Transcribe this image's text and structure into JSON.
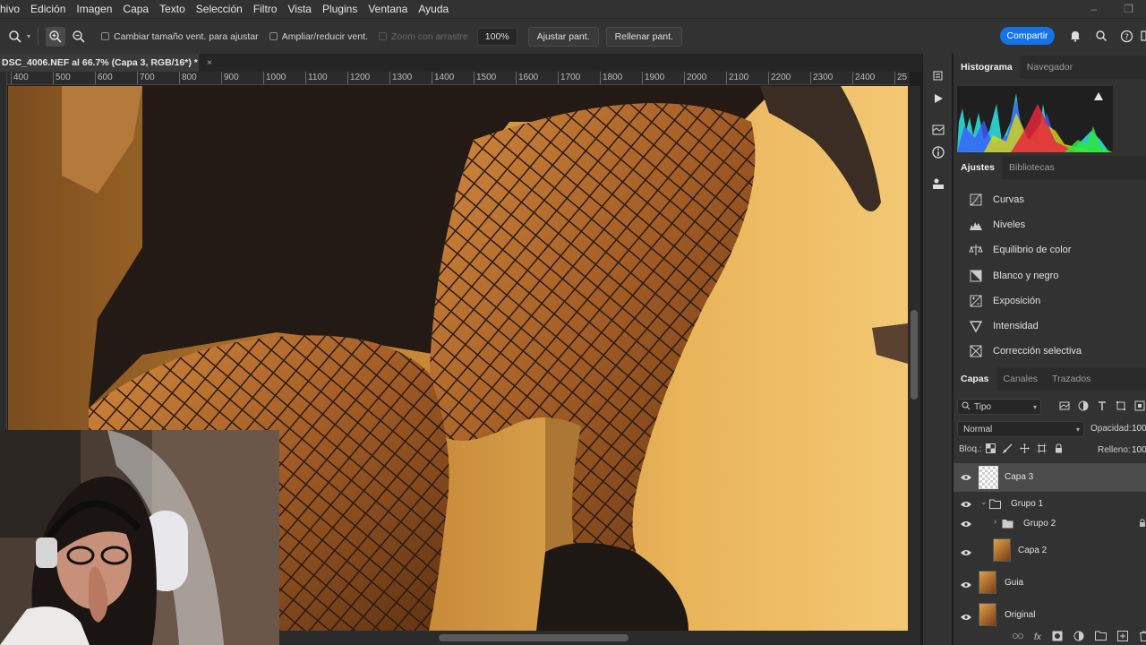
{
  "menu": [
    "chivo",
    "Edición",
    "Imagen",
    "Capa",
    "Texto",
    "Selección",
    "Filtro",
    "Vista",
    "Plugins",
    "Ventana",
    "Ayuda"
  ],
  "window_controls": {
    "minimize": "–",
    "restore": "❐"
  },
  "options": {
    "resize_windows_label": "Cambiar tamaño vent. para ajustar",
    "zoom_all_label": "Ampliar/reducir vent.",
    "scrubby_zoom_label": "Zoom con arrastre",
    "zoom_value": "100%",
    "fit_screen_label": "Ajustar pant.",
    "fill_screen_label": "Rellenar pant.",
    "share_label": "Compartir"
  },
  "document": {
    "tab_title": "DSC_4006.NEF al 66.7% (Capa 3, RGB/16*) *",
    "close_glyph": "×"
  },
  "ruler_ticks": [
    "400",
    "500",
    "600",
    "700",
    "800",
    "900",
    "1000",
    "1100",
    "1200",
    "1300",
    "1400",
    "1500",
    "1600",
    "1700",
    "1800",
    "1900",
    "2000",
    "2100",
    "2200",
    "2300",
    "2400",
    "25"
  ],
  "panels": {
    "histogram_tabs": [
      "Histograma",
      "Navegador"
    ],
    "adjust_tabs": [
      "Ajustes",
      "Bibliotecas"
    ],
    "adjustments": [
      {
        "label": "Curvas",
        "icon": "curves-icon"
      },
      {
        "label": "Niveles",
        "icon": "levels-icon"
      },
      {
        "label": "Equilibrio de color",
        "icon": "color-balance-icon"
      },
      {
        "label": "Blanco y negro",
        "icon": "black-white-icon"
      },
      {
        "label": "Exposición",
        "icon": "exposure-icon"
      },
      {
        "label": "Intensidad",
        "icon": "vibrance-icon"
      },
      {
        "label": "Corrección selectiva",
        "icon": "selective-color-icon"
      }
    ],
    "layers_tabs": [
      "Capas",
      "Canales",
      "Trazados"
    ],
    "filter_kind": "Tipo",
    "blend_mode": "Normal",
    "opacity_label": "Opacidad:",
    "opacity_value": "100",
    "lock_label": "Bloq.:",
    "fill_label": "Relleno:",
    "fill_value": "100",
    "layers": [
      {
        "name": "Capa 3",
        "type": "pixel-empty",
        "selected": true
      },
      {
        "name": "Grupo 1",
        "type": "group-open"
      },
      {
        "name": "Grupo 2",
        "type": "group-closed"
      },
      {
        "name": "Capa 2",
        "type": "pixel"
      },
      {
        "name": "Guia",
        "type": "pixel"
      },
      {
        "name": "Original",
        "type": "pixel"
      }
    ]
  },
  "colors": {
    "accent": "#1473e6",
    "panel": "#323232",
    "canvas_warm": "#c68a34"
  }
}
